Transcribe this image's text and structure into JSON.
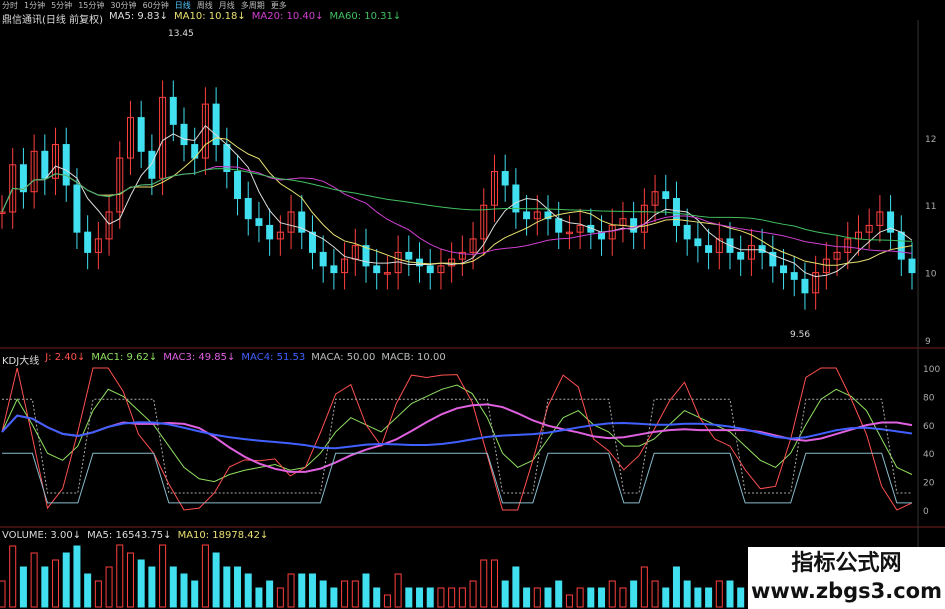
{
  "toolbar": {
    "items": [
      "分时",
      "1分钟",
      "5分钟",
      "15分钟",
      "30分钟",
      "60分钟",
      "日线",
      "周线",
      "月线",
      "多周期",
      "更多"
    ],
    "active_index": 6
  },
  "main": {
    "title": "鼎信通讯(日线 前复权)",
    "ma_labels": [
      {
        "name": "MA5",
        "value": "9.83↓",
        "color": "#dddddd"
      },
      {
        "name": "MA10",
        "value": "10.18↓",
        "color": "#e8e070"
      },
      {
        "name": "MA20",
        "value": "10.40↓",
        "color": "#d040d0"
      },
      {
        "name": "MA60",
        "value": "10.31↓",
        "color": "#40c060"
      }
    ],
    "high_label": "13.45",
    "low_label": "9.56",
    "right_ticks": [
      "12",
      "11",
      "10",
      "9"
    ],
    "small_tags": [
      "跌",
      "涨",
      "跌",
      "涨"
    ]
  },
  "kdj": {
    "title": "KDJ大线",
    "labels": [
      {
        "name": "J",
        "value": "2.40↓",
        "color": "#ff5050"
      },
      {
        "name": "MAC1",
        "value": "9.62↓",
        "color": "#90e060"
      },
      {
        "name": "MAC3",
        "value": "49.85↓",
        "color": "#e060e0"
      },
      {
        "name": "MAC4",
        "value": "51.53",
        "color": "#4060ff"
      },
      {
        "name": "MACA",
        "value": "50.00",
        "color": "#bbbbbb"
      },
      {
        "name": "MACB",
        "value": "10.00",
        "color": "#bbbbbb"
      }
    ],
    "right_ticks": [
      "100",
      "80",
      "60",
      "40",
      "20",
      "0"
    ]
  },
  "volume": {
    "title": "VOLUME",
    "labels": [
      {
        "name": "VOLUME",
        "value": "3.00↓",
        "color": "#dddddd"
      },
      {
        "name": "MA5",
        "value": "16543.75↓",
        "color": "#dddddd"
      },
      {
        "name": "MA10",
        "value": "18978.42↓",
        "color": "#e8e070"
      }
    ]
  },
  "watermark": {
    "title": "指标公式网",
    "url": "www.zbgs3.com"
  },
  "chart_data": {
    "type": "line",
    "y_range_price": [
      9.0,
      13.6
    ],
    "y_range_kdj": [
      0,
      100
    ],
    "close": [
      10.9,
      11.6,
      11.2,
      11.8,
      11.4,
      11.9,
      11.3,
      10.6,
      10.3,
      10.5,
      10.9,
      11.7,
      12.3,
      11.8,
      11.4,
      12.6,
      12.2,
      11.9,
      11.7,
      12.5,
      11.9,
      11.5,
      11.1,
      10.8,
      10.7,
      10.5,
      10.6,
      10.9,
      10.6,
      10.3,
      10.1,
      10.0,
      10.2,
      10.4,
      10.1,
      10.0,
      10.0,
      10.3,
      10.2,
      10.1,
      10.0,
      10.1,
      10.2,
      10.3,
      10.5,
      11.0,
      11.5,
      11.3,
      10.9,
      10.8,
      10.9,
      10.8,
      10.6,
      10.6,
      10.7,
      10.6,
      10.5,
      10.7,
      10.8,
      10.6,
      11.0,
      11.2,
      11.1,
      10.7,
      10.5,
      10.4,
      10.3,
      10.5,
      10.3,
      10.2,
      10.4,
      10.3,
      10.1,
      10.0,
      9.9,
      9.7,
      10.0,
      10.2,
      10.3,
      10.5,
      10.6,
      10.7,
      10.9,
      10.6,
      10.2,
      10.0
    ],
    "kdj_k": [
      55,
      78,
      60,
      40,
      35,
      45,
      70,
      85,
      80,
      70,
      60,
      45,
      30,
      22,
      20,
      25,
      28,
      30,
      32,
      28,
      30,
      40,
      55,
      65,
      60,
      55,
      65,
      75,
      80,
      85,
      88,
      82,
      65,
      40,
      30,
      35,
      50,
      65,
      70,
      60,
      55,
      45,
      45,
      50,
      60,
      70,
      65,
      60,
      55,
      45,
      35,
      30,
      40,
      60,
      78,
      85,
      80,
      70,
      50,
      30,
      25
    ]
  }
}
